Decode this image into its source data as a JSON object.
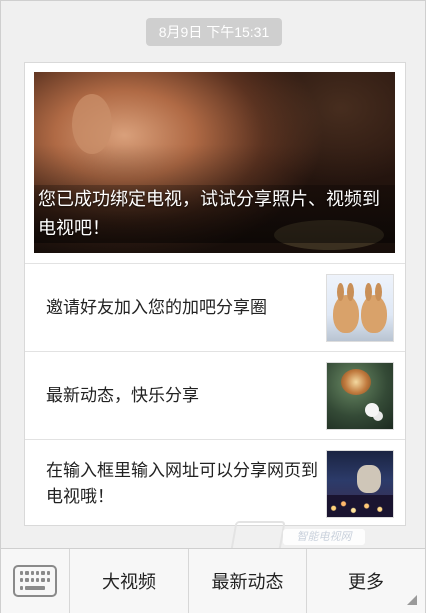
{
  "header": {
    "timestamp": "8月9日 下午15:31"
  },
  "message": {
    "cover": {
      "caption": "您已成功绑定电视，试试分享照片、视频到电视吧！"
    },
    "items": [
      {
        "text": "邀请好友加入您的加吧分享圈",
        "thumb_icon": "rabbits-thumbnail"
      },
      {
        "text": "最新动态，快乐分享",
        "thumb_icon": "snail-thumbnail"
      },
      {
        "text": "在输入框里输入网址可以分享网页到电视哦！",
        "thumb_icon": "city-cat-thumbnail"
      }
    ]
  },
  "watermark": {
    "text": "智能电视网"
  },
  "tabbar": {
    "keyboard_icon": "keyboard-icon",
    "tabs": [
      {
        "label": "大视频"
      },
      {
        "label": "最新动态"
      },
      {
        "label": "更多"
      }
    ]
  },
  "colors": {
    "background": "#f0f0f0",
    "card": "#ffffff",
    "timestamp_bg": "#cfcfcf"
  }
}
